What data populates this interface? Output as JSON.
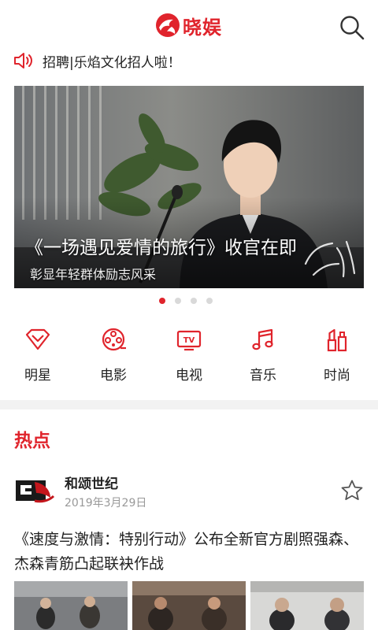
{
  "header": {
    "brand_name": "晓娱"
  },
  "notice": {
    "text": "招聘|乐焰文化招人啦！"
  },
  "banner": {
    "title": "《一场遇见爱情的旅行》收官在即",
    "subtitle": "彰显年轻群体励志风采",
    "slide_count": 4,
    "active_slide": 1
  },
  "categories": [
    {
      "label": "明星",
      "icon": "diamond-icon"
    },
    {
      "label": "电影",
      "icon": "film-reel-icon"
    },
    {
      "label": "电视",
      "icon": "tv-icon"
    },
    {
      "label": "音乐",
      "icon": "music-note-icon"
    },
    {
      "label": "时尚",
      "icon": "lipstick-icon"
    }
  ],
  "section": {
    "title": "热点"
  },
  "post": {
    "author": "和颂世纪",
    "date": "2019年3月29日",
    "title": "《速度与激情：特别行动》公布全新官方剧照强森、杰森青筋凸起联袂作战"
  },
  "colors": {
    "accent": "#e0242c",
    "muted": "#999999",
    "divider": "#f2f2f2"
  }
}
